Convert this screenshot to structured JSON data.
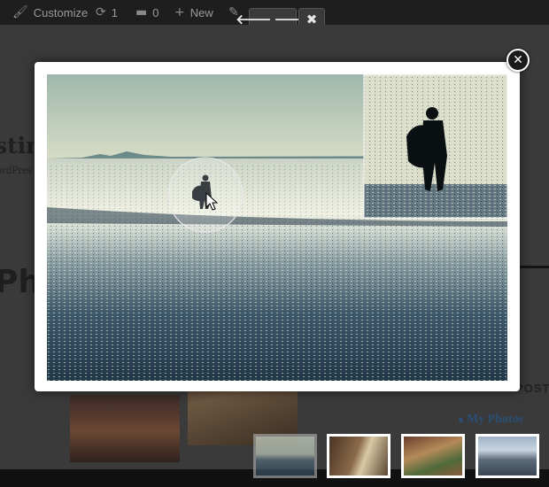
{
  "adminbar": {
    "customize_label": "Customize",
    "updates_count": "1",
    "comments_count": "0",
    "new_label": "New"
  },
  "viewer_controls": {
    "prev_next_icons": "arrow-left-right-icon",
    "close_icon": "close-icon"
  },
  "page": {
    "site_title": "stin",
    "site_description": "ordPres",
    "heading": "Pho",
    "sidebar_heading": "POST",
    "sidebar_links": [
      "My Photos"
    ]
  },
  "lightbox": {
    "image_subject": "surfer-silhouette-on-beach",
    "magnifier": "zoom-lens-icon",
    "close_icon": "close-circle-icon"
  },
  "thumbnails": {
    "count": 4,
    "active_index": 0
  },
  "colors": {
    "adminbar_bg": "#1e1e1e",
    "link": "#2a4f73",
    "lightbox_bg": "#ffffff"
  }
}
